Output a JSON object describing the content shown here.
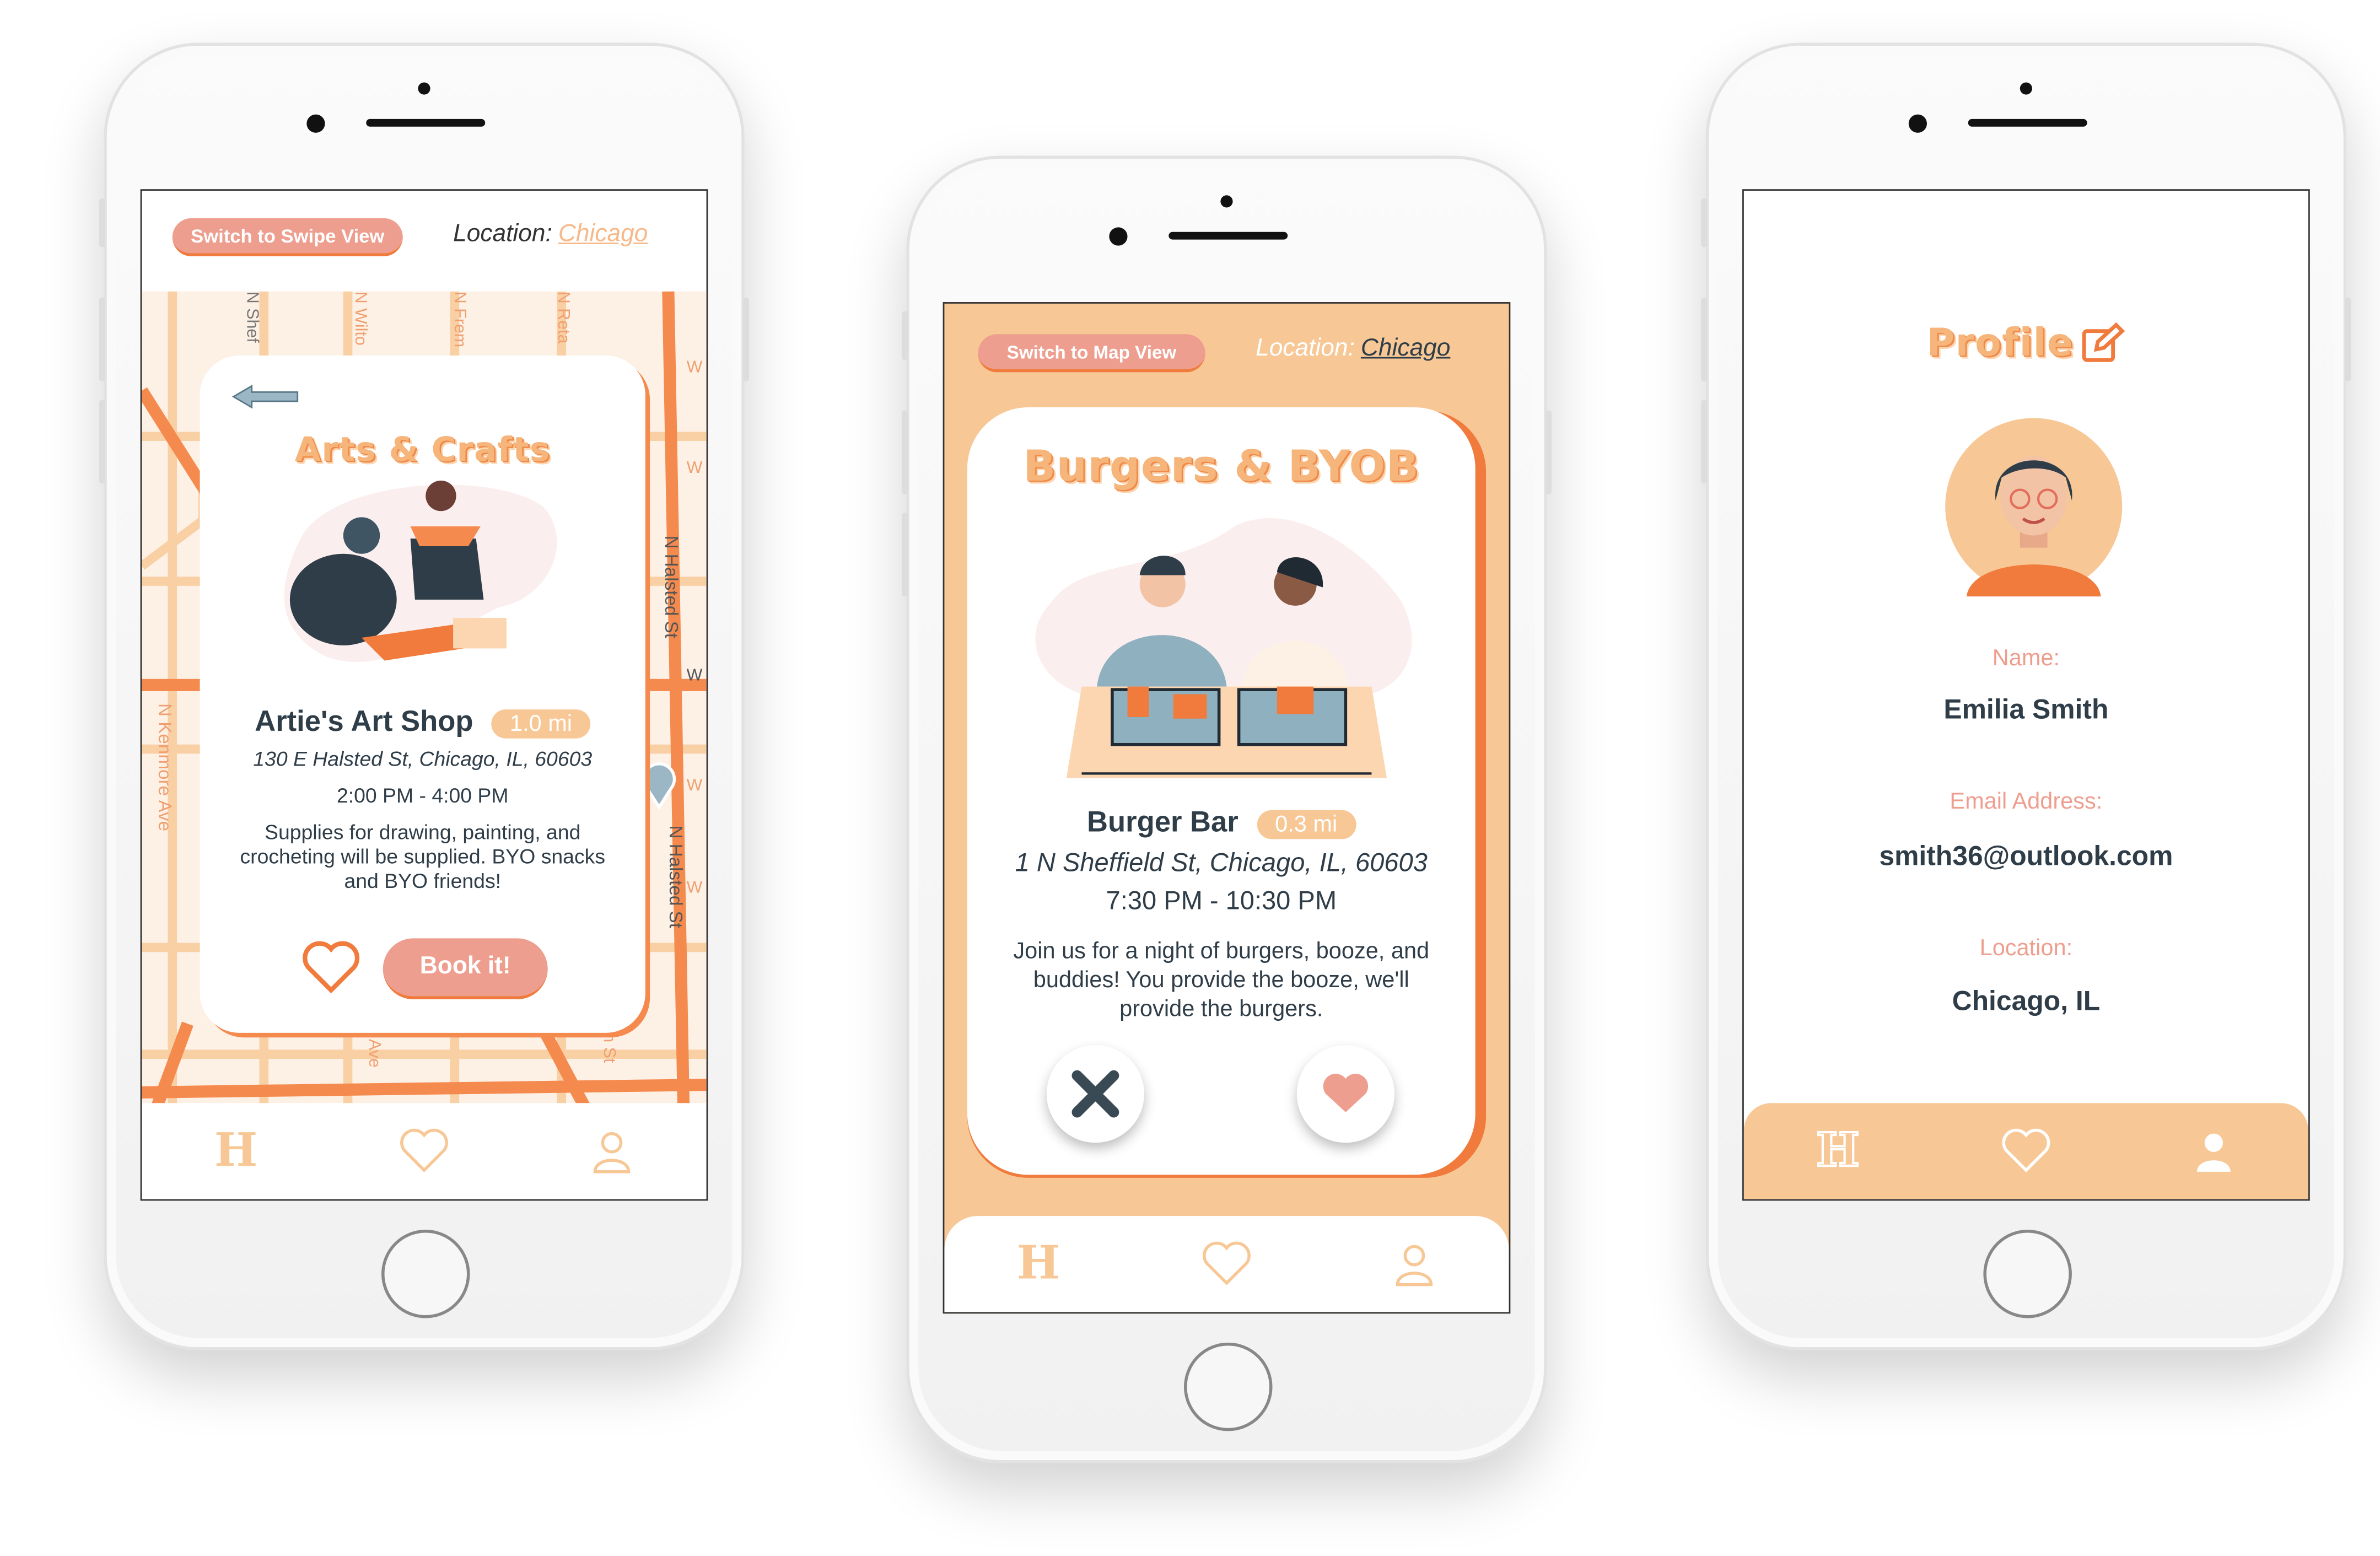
{
  "colors": {
    "accent_orange": "#f07b3c",
    "peach": "#f7c896",
    "salmon": "#ee9e8f",
    "text_dark": "#2f3d48",
    "map_bg": "#fdf1e6"
  },
  "map_view": {
    "switch_button": "Switch to Swipe View",
    "location_label": "Location:",
    "location_value": "Chicago",
    "street_labels": [
      "N Shef",
      "N Wilto",
      "N Frem",
      "N Reta",
      "N Halsted St",
      "N Halsted St",
      "N Kenmore Ave",
      "W",
      "W",
      "W",
      "W",
      "W",
      "Ave",
      "on St"
    ],
    "card": {
      "back_icon": "arrow-left-icon",
      "category": "Arts & Crafts",
      "venue": "Artie's Art Shop",
      "distance": "1.0 mi",
      "address": "130 E Halsted St, Chicago, IL, 60603",
      "time": "2:00 PM - 4:00 PM",
      "description": "Supplies for drawing, painting, and crocheting will be supplied. BYO snacks and BYO friends!",
      "book_button": "Book it!"
    },
    "nav": [
      "home-icon",
      "heart-icon",
      "user-icon"
    ],
    "nav_home_glyph": "H"
  },
  "swipe_view": {
    "switch_button": "Switch to Map View",
    "location_label": "Location:",
    "location_value": "Chicago",
    "card": {
      "category": "Burgers & BYOB",
      "venue": "Burger Bar",
      "distance": "0.3 mi",
      "address": "1 N Sheffield St, Chicago, IL, 60603",
      "time": "7:30 PM - 10:30 PM",
      "description": "Join us for a night of burgers, booze, and buddies! You provide the booze, we'll provide the burgers."
    },
    "nav_home_glyph": "H"
  },
  "profile_view": {
    "title": "Profile",
    "name_label": "Name:",
    "name_value": "Emilia Smith",
    "email_label": "Email Address:",
    "email_value": "smith36@outlook.com",
    "location_label": "Location:",
    "location_value": "Chicago, IL",
    "nav_home_glyph": "H"
  }
}
